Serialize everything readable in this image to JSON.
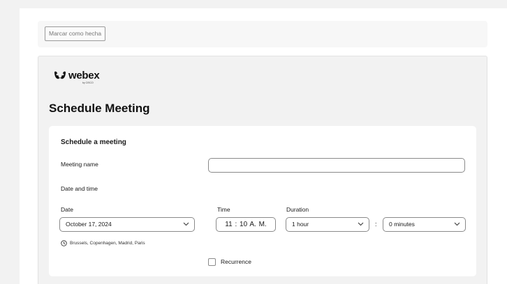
{
  "toolbar": {
    "mark_done_label": "Marcar como hecha"
  },
  "brand": {
    "name": "webex",
    "byline": "by CISCO"
  },
  "page": {
    "title": "Schedule Meeting"
  },
  "form": {
    "section_title": "Schedule a meeting",
    "meeting_name_label": "Meeting name",
    "meeting_name_value": "",
    "date_time_label": "Date and time",
    "date_label": "Date",
    "date_value": "October 17, 2024",
    "time_label": "Time",
    "time_value": "11 : 10  A. M.",
    "duration_label": "Duration",
    "duration_hours": "1 hour",
    "duration_separator": ":",
    "duration_minutes": "0 minutes",
    "timezone": "Brussels, Copenhagen, Madrid, Paris",
    "recurrence_label": "Recurrence",
    "recurrence_checked": false
  },
  "icons": {
    "logo": "webex-logo-icon",
    "timezone": "clock-icon",
    "dropdown": "chevron-down-icon"
  }
}
